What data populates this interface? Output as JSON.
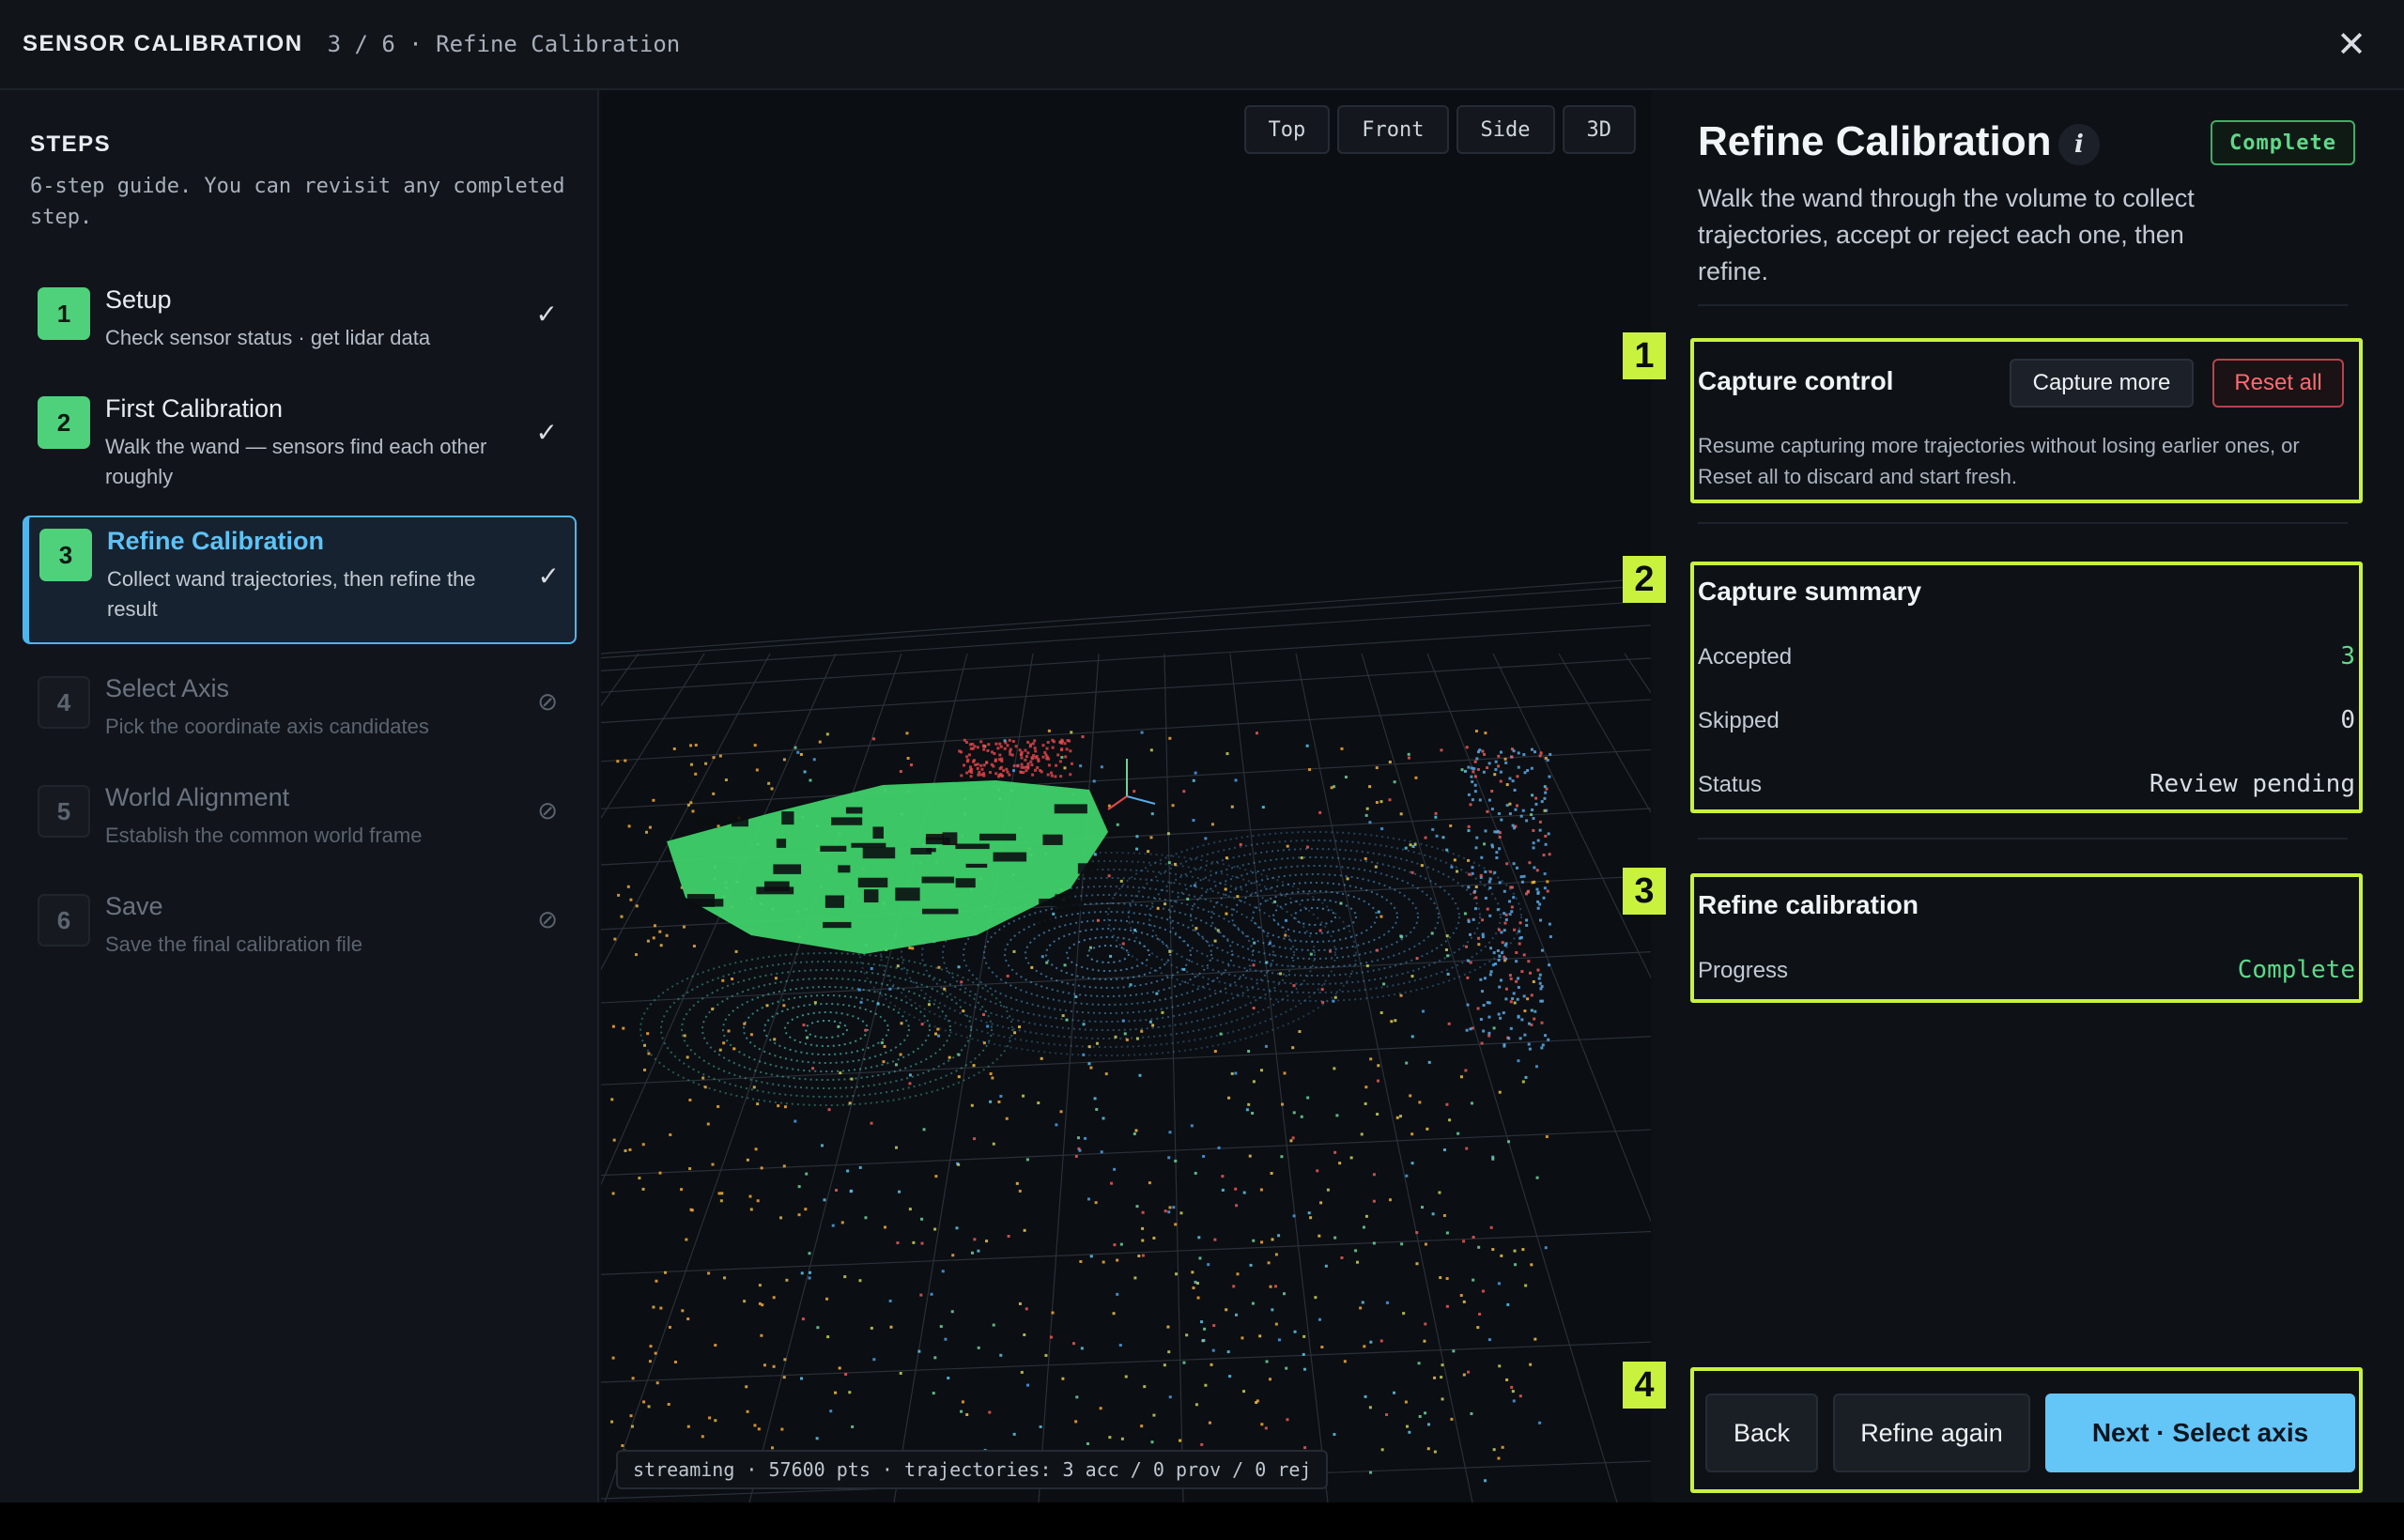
{
  "header": {
    "title": "SENSOR CALIBRATION",
    "crumb": "3 / 6 · Refine Calibration",
    "close_glyph": "✕"
  },
  "sidebar": {
    "heading": "STEPS",
    "description": "6-step guide. You can revisit any completed step.",
    "steps": [
      {
        "num": "1",
        "title": "Setup",
        "sub": "Check sensor status · get lidar data",
        "state": "done",
        "mark": "✓"
      },
      {
        "num": "2",
        "title": "First Calibration",
        "sub": "Walk the wand — sensors find each other roughly",
        "state": "done",
        "mark": "✓"
      },
      {
        "num": "3",
        "title": "Refine Calibration",
        "sub": "Collect wand trajectories, then refine the result",
        "state": "active",
        "mark": "✓"
      },
      {
        "num": "4",
        "title": "Select Axis",
        "sub": "Pick the coordinate axis candidates",
        "state": "locked",
        "mark": "⊘"
      },
      {
        "num": "5",
        "title": "World Alignment",
        "sub": "Establish the common world frame",
        "state": "locked",
        "mark": "⊘"
      },
      {
        "num": "6",
        "title": "Save",
        "sub": "Save the final calibration file",
        "state": "locked",
        "mark": "⊘"
      }
    ]
  },
  "viewport": {
    "view_tabs": [
      "Top",
      "Front",
      "Side",
      "3D"
    ],
    "status": "streaming · 57600 pts · trajectories: 3 acc / 0 prov / 0 rej"
  },
  "panel": {
    "title": "Refine Calibration",
    "info_glyph": "i",
    "status_pill": "Complete",
    "description": "Walk the wand through the volume to collect trajectories, accept or reject each one, then refine.",
    "capture_control": {
      "badge": "1",
      "title": "Capture control",
      "capture_more": "Capture more",
      "reset_all": "Reset all",
      "description": "Resume capturing more trajectories without losing earlier ones, or Reset all to discard and start fresh."
    },
    "capture_summary": {
      "badge": "2",
      "title": "Capture summary",
      "rows": [
        {
          "label": "Accepted",
          "value": "3"
        },
        {
          "label": "Skipped",
          "value": "0"
        },
        {
          "label": "Status",
          "value": "Review pending"
        }
      ]
    },
    "refine": {
      "badge": "3",
      "title": "Refine calibration",
      "progress_label": "Progress",
      "progress_value": "Complete"
    },
    "footer": {
      "badge": "4",
      "back": "Back",
      "refine_again": "Refine again",
      "next": "Next · Select axis"
    }
  },
  "colors": {
    "accent": "#4eb6ef",
    "success": "#4fd17c",
    "danger": "#ff6a72",
    "highlight": "#c9f23f"
  }
}
